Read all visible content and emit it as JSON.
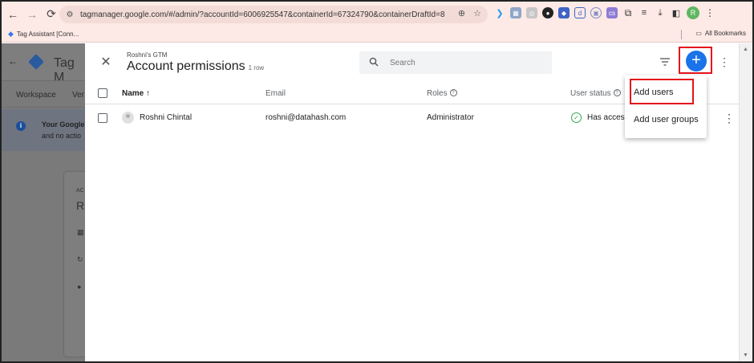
{
  "browser": {
    "url": "tagmanager.google.com/#/admin/?accountId=6006925547&containerId=67324790&containerDraftId=8",
    "bookmark_tag_assistant": "Tag Assistant [Conn...",
    "all_bookmarks": "All Bookmarks",
    "profile_initial": "R"
  },
  "background": {
    "app_title": "Tag M",
    "tab_workspace": "Workspace",
    "tab_versions": "Ver",
    "notice_line1": "Your Google",
    "notice_line2": "and no actio",
    "card_small_label": "AC",
    "card_letter": "R"
  },
  "dialog": {
    "account_name": "Roshni's GTM",
    "title": "Account permissions",
    "row_count": "1 row",
    "search_placeholder": "Search",
    "columns": {
      "name": "Name",
      "email": "Email",
      "roles": "Roles",
      "user_status": "User status"
    },
    "rows": [
      {
        "name": "Roshni Chintal",
        "email": "roshni@datahash.com",
        "role": "Administrator",
        "status": "Has access"
      }
    ],
    "menu": {
      "add_users": "Add users",
      "add_user_groups": "Add user groups"
    }
  },
  "colors": {
    "accent_blue": "#1a73e8",
    "highlight_red": "#e3141c",
    "status_green": "#34a853"
  }
}
